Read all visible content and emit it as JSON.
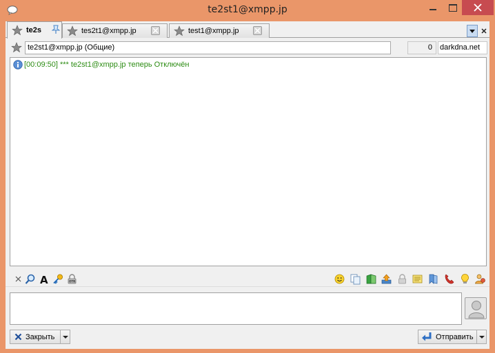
{
  "window": {
    "title": "te2st1@xmpp.jp"
  },
  "tabs": [
    {
      "label": "te2s",
      "active": true,
      "pinned": true
    },
    {
      "label": "tes2t1@xmpp.jp",
      "active": false
    },
    {
      "label": "test1@xmpp.jp",
      "active": false
    }
  ],
  "address": {
    "value": "te2st1@xmpp.jp (Общие)",
    "count": "0",
    "nick": "darkdna.net"
  },
  "chat": {
    "messages": [
      {
        "text": "[00:09:50] *** te2st1@xmpp.jp теперь Отключён",
        "color": "#2b8b12",
        "icon": "info-icon"
      }
    ]
  },
  "toolbar": {
    "left_icons": [
      "cross-small-icon",
      "search-contact-icon",
      "font-icon",
      "key-icon",
      "otr-lock-icon"
    ],
    "right_icons": [
      "smiley-icon",
      "copy-pages-icon",
      "book-icon",
      "upload-icon",
      "lock-icon",
      "notepad-icon",
      "bookmark-icon",
      "phone-icon",
      "lightbulb-icon",
      "contacts-icon"
    ]
  },
  "buttons": {
    "close_label": "Закрыть",
    "send_label": "Отправить"
  },
  "colors": {
    "frame": "#ea9669",
    "close_button": "#c74b50",
    "message_text": "#2b8b12"
  }
}
